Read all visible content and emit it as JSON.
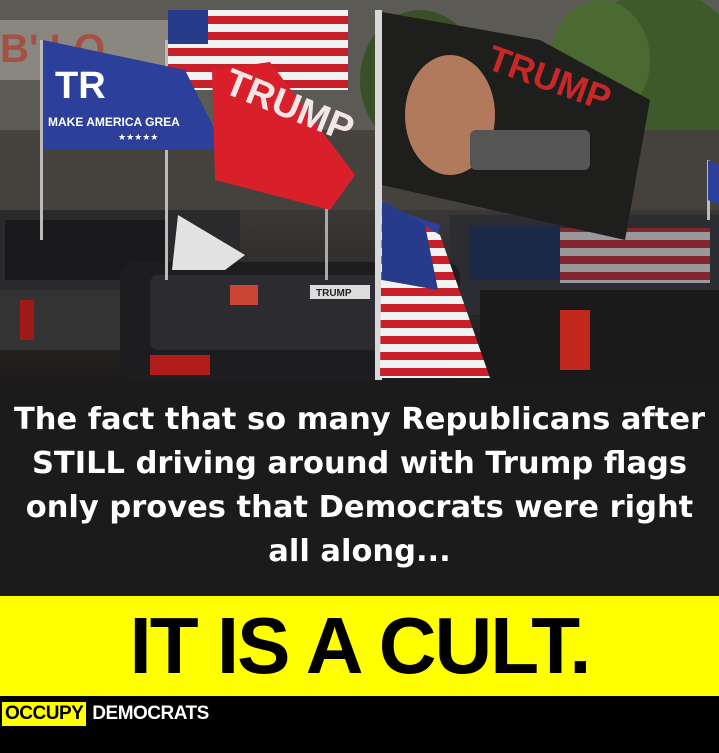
{
  "photo": {
    "description_icon": "photo-icon",
    "flag_left_text_line1": "TR",
    "flag_left_text_line2": "MAKE AMERICA GREA",
    "flag_left_stars": "★★★★★",
    "flag_red_text": "TRUMP",
    "flag_black_text": "TRUMP",
    "sticker_text": "TRUMP"
  },
  "caption": {
    "text": "The fact that so many Republicans after STILL driving around with Trump flags only proves that Democrats were right all along..."
  },
  "headline": {
    "text": "IT IS A CULT."
  },
  "brand": {
    "occupy": "OCCUPY",
    "democrats": "DEMOCRATS"
  },
  "colors": {
    "yellow": "#ffff00",
    "caption_bg": "#1b1b1b",
    "flag_blue": "#2c3f9b",
    "flag_red": "#d81f2a"
  }
}
